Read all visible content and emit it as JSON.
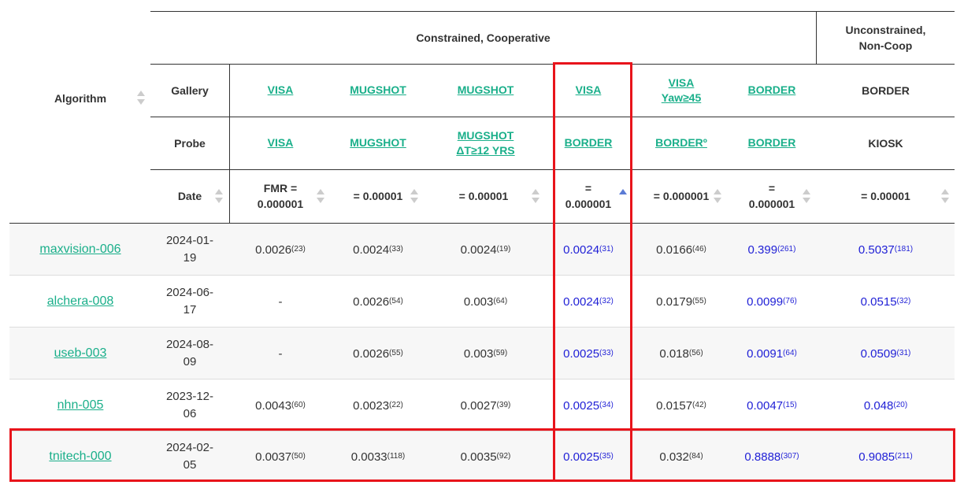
{
  "header": {
    "algorithm": "Algorithm",
    "constrained": "Constrained, Cooperative",
    "unconstrained_line1": "Unconstrained,",
    "unconstrained_line2": "Non-Coop",
    "gallery": "Gallery",
    "probe": "Probe",
    "date": "Date"
  },
  "columns": [
    {
      "gallery": "VISA",
      "gallery2": "",
      "probe": "VISA",
      "probe2": "",
      "fmr1": "FMR =",
      "fmr2": "0.000001",
      "link": true
    },
    {
      "gallery": "MUGSHOT",
      "gallery2": "",
      "probe": "MUGSHOT",
      "probe2": "",
      "fmr1": "= 0.00001",
      "fmr2": "",
      "link": true
    },
    {
      "gallery": "MUGSHOT",
      "gallery2": "",
      "probe": "MUGSHOT",
      "probe2": "ΔT≥12 YRS",
      "fmr1": "= 0.00001",
      "fmr2": "",
      "link": true
    },
    {
      "gallery": "VISA",
      "gallery2": "",
      "probe": "BORDER",
      "probe2": "",
      "fmr1": "=",
      "fmr2": "0.000001",
      "link": true
    },
    {
      "gallery": "VISA",
      "gallery2": "Yaw≥45",
      "probe": "BORDERº",
      "probe2": "",
      "fmr1": "= 0.000001",
      "fmr2": "",
      "link": true
    },
    {
      "gallery": "BORDER",
      "gallery2": "",
      "probe": "BORDER",
      "probe2": "",
      "fmr1": "=",
      "fmr2": "0.000001",
      "link": true
    },
    {
      "gallery": "BORDER",
      "gallery2": "",
      "probe": "KIOSK",
      "probe2": "",
      "fmr1": "= 0.00001",
      "fmr2": "",
      "link": false
    }
  ],
  "rows": [
    {
      "name": "maxvision-006",
      "date1": "2024-01-",
      "date2": "19",
      "values": [
        [
          "0.0026",
          "(23)"
        ],
        [
          "0.0024",
          "(33)"
        ],
        [
          "0.0024",
          "(19)"
        ],
        [
          "0.0024",
          "(31)"
        ],
        [
          "0.0166",
          "(46)"
        ],
        [
          "0.399",
          "(261)"
        ],
        [
          "0.5037",
          "(181)"
        ]
      ]
    },
    {
      "name": "alchera-008",
      "date1": "2024-06-",
      "date2": "17",
      "values": [
        [
          "-",
          ""
        ],
        [
          "0.0026",
          "(54)"
        ],
        [
          "0.003",
          "(64)"
        ],
        [
          "0.0024",
          "(32)"
        ],
        [
          "0.0179",
          "(55)"
        ],
        [
          "0.0099",
          "(76)"
        ],
        [
          "0.0515",
          "(32)"
        ]
      ]
    },
    {
      "name": "useb-003",
      "date1": "2024-08-",
      "date2": "09",
      "values": [
        [
          "-",
          ""
        ],
        [
          "0.0026",
          "(55)"
        ],
        [
          "0.003",
          "(59)"
        ],
        [
          "0.0025",
          "(33)"
        ],
        [
          "0.018",
          "(56)"
        ],
        [
          "0.0091",
          "(64)"
        ],
        [
          "0.0509",
          "(31)"
        ]
      ]
    },
    {
      "name": "nhn-005",
      "date1": "2023-12-",
      "date2": "06",
      "values": [
        [
          "0.0043",
          "(60)"
        ],
        [
          "0.0023",
          "(22)"
        ],
        [
          "0.0027",
          "(39)"
        ],
        [
          "0.0025",
          "(34)"
        ],
        [
          "0.0157",
          "(42)"
        ],
        [
          "0.0047",
          "(15)"
        ],
        [
          "0.048",
          "(20)"
        ]
      ]
    },
    {
      "name": "tnitech-000",
      "date1": "2024-02-",
      "date2": "05",
      "values": [
        [
          "0.0037",
          "(50)"
        ],
        [
          "0.0033",
          "(118)"
        ],
        [
          "0.0035",
          "(92)"
        ],
        [
          "0.0025",
          "(35)"
        ],
        [
          "0.032",
          "(84)"
        ],
        [
          "0.8888",
          "(307)"
        ],
        [
          "0.9085",
          "(211)"
        ]
      ]
    }
  ],
  "colors": {
    "link": "#1aaf8a",
    "blue_value": "#1f1fd6",
    "highlight": "#e8141b",
    "odd_row": "#f7f7f7"
  }
}
